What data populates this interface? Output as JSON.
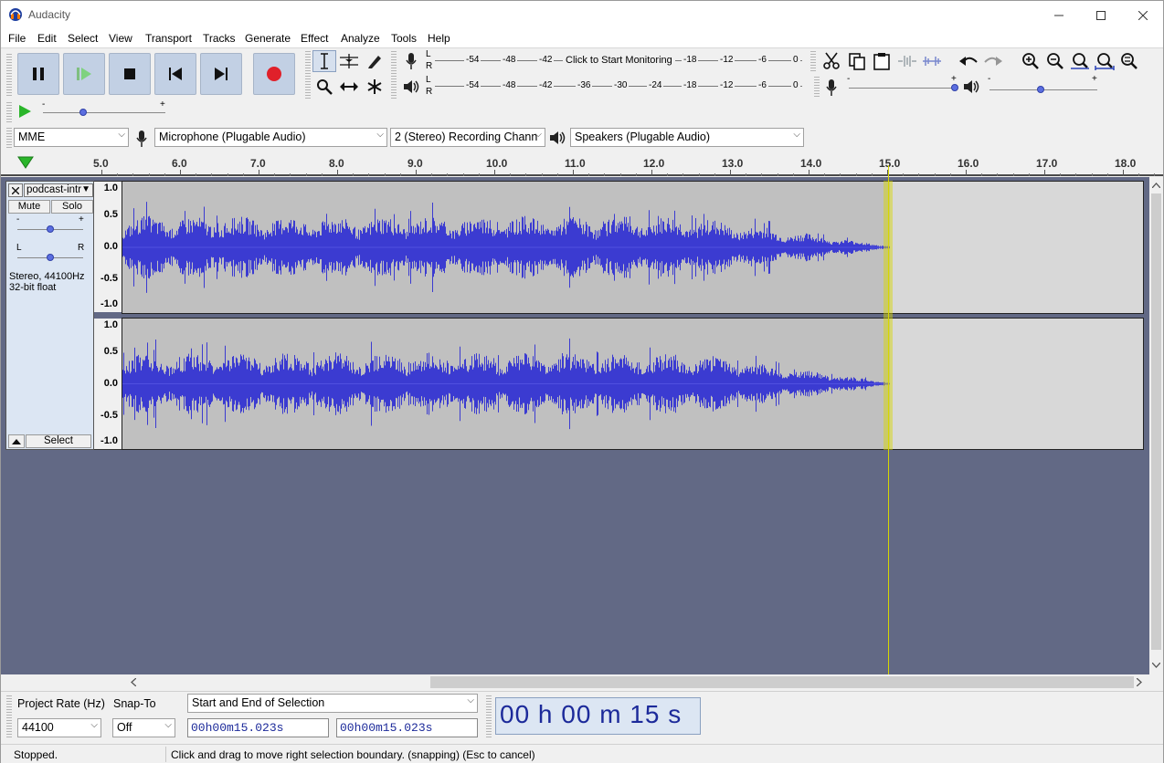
{
  "window": {
    "title": "Audacity"
  },
  "menu": [
    "File",
    "Edit",
    "Select",
    "View",
    "Transport",
    "Tracks",
    "Generate",
    "Effect",
    "Analyze",
    "Tools",
    "Help"
  ],
  "meters": {
    "record_labels": [
      "-54",
      "-48",
      "-42",
      "-18",
      "-12",
      "-6",
      "0"
    ],
    "record_prompt": "Click to Start Monitoring",
    "play_labels": [
      "-54",
      "-48",
      "-42",
      "-36",
      "-30",
      "-24",
      "-18",
      "-12",
      "-6",
      "0"
    ],
    "lr_top": "L",
    "lr_bottom": "R",
    "slider_minus": "-",
    "slider_plus": "+"
  },
  "devices": {
    "host": "MME",
    "recording_device": "Microphone (Plugable Audio)",
    "channels": "2 (Stereo) Recording Chann",
    "playback_device": "Speakers (Plugable Audio)"
  },
  "ruler": {
    "labels": [
      "5.0",
      "6.0",
      "7.0",
      "8.0",
      "9.0",
      "10.0",
      "11.0",
      "12.0",
      "13.0",
      "14.0",
      "15.0",
      "16.0",
      "17.0",
      "18.0"
    ]
  },
  "track": {
    "name": "podcast-intr",
    "mute": "Mute",
    "solo": "Solo",
    "gain_minus": "-",
    "gain_plus": "+",
    "pan_left": "L",
    "pan_right": "R",
    "info_line1": "Stereo, 44100Hz",
    "info_line2": "32-bit float",
    "select": "Select",
    "scale_labels": [
      "1.0",
      "0.5",
      "0.0",
      "-0.5",
      "-1.0"
    ]
  },
  "selection": {
    "project_rate_label": "Project Rate (Hz)",
    "snap_to_label": "Snap-To",
    "project_rate": "44100",
    "snap_to": "Off",
    "mode": "Start and End of Selection",
    "start": "00h00m15.023s",
    "end": "00h00m15.023s",
    "audio_position": "00 h 00 m 15 s"
  },
  "status": {
    "state": "Stopped.",
    "message": "Click and drag to move right selection boundary. (snapping) (Esc to cancel)"
  },
  "colors": {
    "accent": "#3b3bd1",
    "cursor": "#d6d600",
    "track_bg": "#626985",
    "transport_button": "#c2d0e4"
  }
}
